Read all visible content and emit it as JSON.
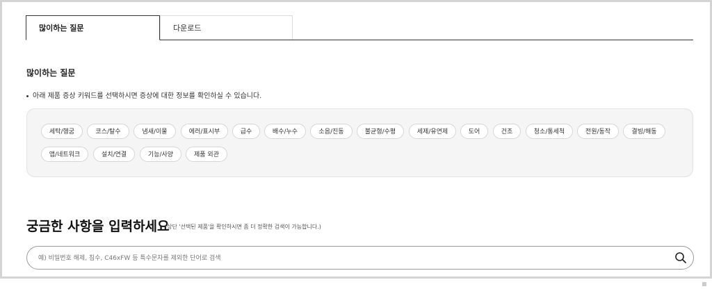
{
  "tabs": [
    {
      "label": "많이하는 질문",
      "active": true
    },
    {
      "label": "다운로드",
      "active": false
    }
  ],
  "faq": {
    "title": "많이하는 질문",
    "notice": "아래 제품 증상 키워드를 선택하시면 증상에 대한 정보를 확인하실 수 있습니다.",
    "chips": [
      "세탁/헹굼",
      "코스/탈수",
      "냄새/이물",
      "에러/표시부",
      "급수",
      "배수/누수",
      "소음/진동",
      "불균형/수평",
      "세제/유연제",
      "도어",
      "건조",
      "청소/통세척",
      "전원/동작",
      "결빙/해동",
      "앱/네트워크",
      "설치/연결",
      "기능/사양",
      "제품 외관"
    ]
  },
  "search": {
    "title": "궁금한 사항을 입력하세요",
    "note": "(상단 '선택된 제품'을 확인하시면 좀 더 정확한 검색이 가능합니다.)",
    "placeholder": "예) 비밀번호 해제, 침수, C46xFW 등 특수문자를 제외한 단어로 검색",
    "icon": "search-icon"
  }
}
